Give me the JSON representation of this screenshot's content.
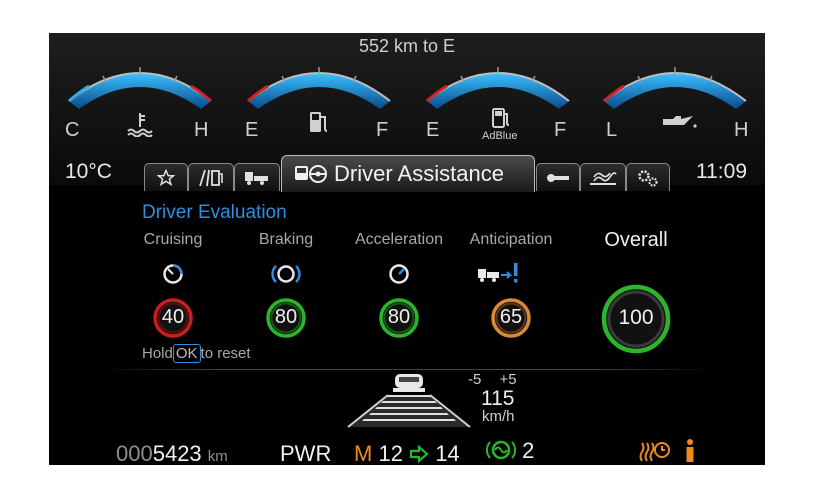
{
  "gauges": {
    "range_text": "552 km to E",
    "coolant": {
      "low": "C",
      "high": "H",
      "icon": "coolant-temperature-icon"
    },
    "fuel": {
      "low": "E",
      "high": "F",
      "icon": "fuel-pump-icon"
    },
    "adblue": {
      "low": "E",
      "high": "F",
      "icon": "adblue-icon",
      "label": "AdBlue"
    },
    "oil": {
      "low": "L",
      "high": "H",
      "icon": "oil-can-icon"
    }
  },
  "status": {
    "outside_temp": "10°C",
    "clock": "11:09"
  },
  "tabs": {
    "left_icons": [
      "star-icon",
      "road-fuel-icon",
      "truck-icon"
    ],
    "active_label": "Driver Assistance",
    "active_icon": "driver-assistance-icon",
    "right_icons": [
      "wrench-icon",
      "exhaust-heat-icon",
      "gears-icon"
    ]
  },
  "evaluation": {
    "title": "Driver Evaluation",
    "categories": [
      {
        "label": "Cruising",
        "score": "40",
        "color": "#c81e1e",
        "icon": "cruising-gauge-icon"
      },
      {
        "label": "Braking",
        "score": "80",
        "color": "#2bb52b",
        "icon": "brake-icon"
      },
      {
        "label": "Acceleration",
        "score": "80",
        "color": "#2bb52b",
        "icon": "acceleration-gauge-icon"
      },
      {
        "label": "Anticipation",
        "score": "65",
        "color": "#d88a3a",
        "icon": "anticipation-truck-icon"
      }
    ],
    "overall_label": "Overall",
    "overall_score": "100",
    "overall_color": "#2bb52b",
    "reset_prefix": "Hold",
    "reset_key": "OK",
    "reset_suffix": "to reset"
  },
  "cruise": {
    "minus": "-5",
    "plus": "+5",
    "speed": "115",
    "unit": "km/h"
  },
  "bottom": {
    "odo_lead": "000",
    "odo_main": "5423",
    "odo_unit": "km",
    "mode": "PWR",
    "gear_mode": "M",
    "gear_current": "12",
    "gear_next": "14",
    "retarder_level": "2"
  },
  "colors": {
    "accent_blue": "#2f8ee0",
    "warning_orange": "#f08a1e",
    "good_green": "#2bb52b",
    "bad_red": "#c81e1e"
  }
}
